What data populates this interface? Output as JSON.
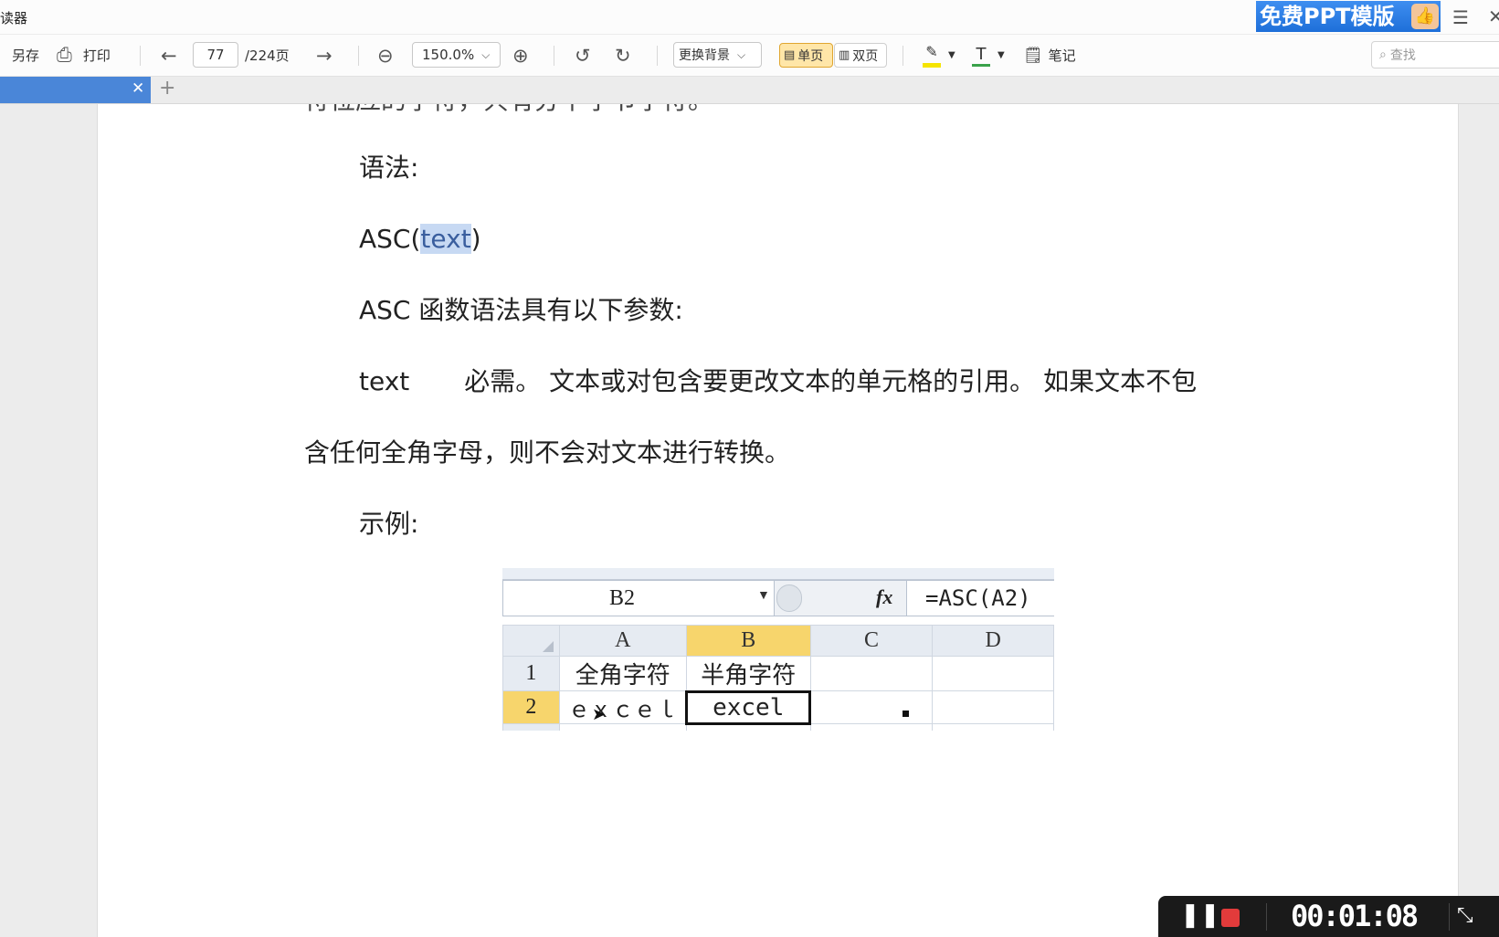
{
  "app": {
    "title": "读器"
  },
  "ad_banner": {
    "text": "免费PPT模版"
  },
  "toolbar": {
    "save_as": "另存",
    "print": "打印",
    "page_current": "77",
    "page_total": "/224页",
    "zoom": "150.0%",
    "background": "更换背景",
    "single_page": "单页",
    "double_page": "双页",
    "notes": "笔记",
    "text_tool": "T",
    "search_placeholder": "查找"
  },
  "document": {
    "cut_line": "符位应的字符，共有分下字节字符。",
    "syntax_label": "语法:",
    "syntax_prefix": "ASC(",
    "syntax_arg": "text",
    "syntax_suffix": ")",
    "params_intro": "ASC  函数语法具有以下参数:",
    "param_name": "text",
    "param_desc": "必需。 文本或对包含要更改文本的单元格的引用。 如果文本不包",
    "param_desc_cont": "含任何全角字母，则不会对文本进行转换。",
    "example_label": "示例:"
  },
  "excel": {
    "name_box": "B2",
    "formula": "=ASC(A2)",
    "columns": [
      "A",
      "B",
      "C",
      "D"
    ],
    "rows": [
      {
        "num": "1",
        "cells": [
          "全角字符",
          "半角字符",
          "",
          ""
        ]
      },
      {
        "num": "2",
        "cells": [
          "ｅｘｃｅｌ",
          "excel",
          "",
          ""
        ]
      }
    ]
  },
  "recorder": {
    "time": "00:01:08"
  },
  "colors": {
    "accent_tab": "#4a86d8",
    "selected_header": "#f7d56c",
    "record_stop": "#e23b3b"
  }
}
